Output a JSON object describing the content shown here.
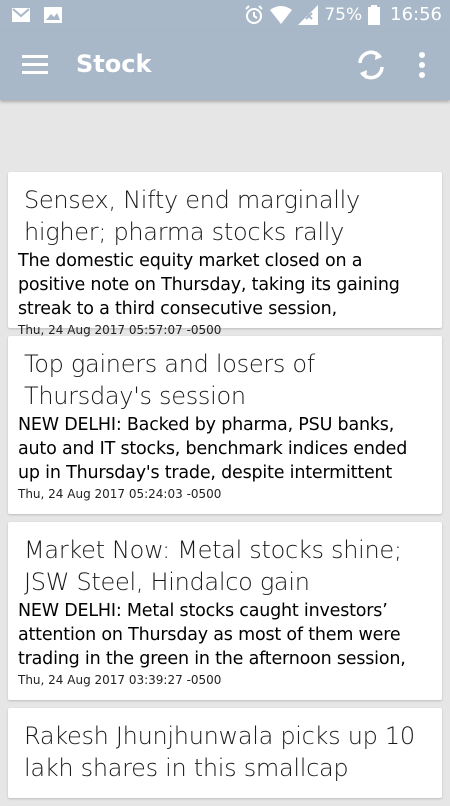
{
  "status_bar": {
    "icons_left": [
      "gmail-icon",
      "image-icon"
    ],
    "icons_right": [
      "alarm-icon",
      "wifi-icon",
      "signal-icon"
    ],
    "battery_percent": "75%",
    "time": "16:56"
  },
  "app_bar": {
    "title": "Stock",
    "background": "#a9b8c9"
  },
  "articles": [
    {
      "title": "Sensex, Nifty end marginally higher; pharma stocks rally",
      "description": "The domestic equity market closed on a positive note on Thursday, taking its gaining streak to a third consecutive session,",
      "date": "Thu, 24 Aug 2017 05:57:07 -0500"
    },
    {
      "title": "Top gainers and losers of Thursday's session",
      "description": "NEW DELHI: Backed by pharma, PSU banks, auto and IT stocks, benchmark indices ended up in Thursday's trade, despite intermittent",
      "date": "Thu, 24 Aug 2017 05:24:03 -0500"
    },
    {
      "title": "Market Now: Metal stocks shine; JSW Steel, Hindalco gain",
      "description": "NEW DELHI: Metal stocks caught investors’ attention on Thursday as most of them were trading in the green in the afternoon session,",
      "date": "Thu, 24 Aug 2017 03:39:27 -0500"
    },
    {
      "title": "Rakesh Jhunjhunwala picks up 10 lakh shares in this smallcap",
      "description": "",
      "date": ""
    }
  ]
}
